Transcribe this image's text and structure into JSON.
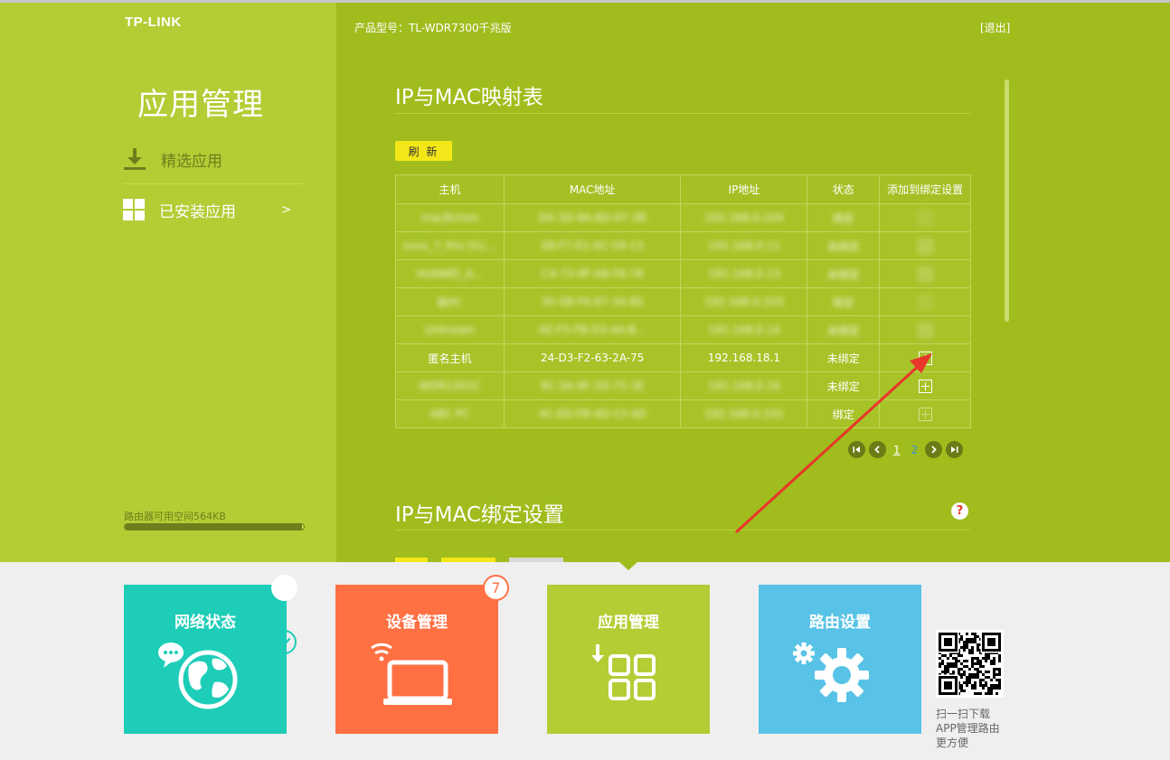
{
  "header": {
    "brand": "TP-LINK",
    "product": "产品型号：TL-WDR7300千兆版",
    "logout": "[退出]"
  },
  "sidebar": {
    "title": "应用管理",
    "items": [
      {
        "label": "精选应用",
        "icon": "download-icon",
        "active": false
      },
      {
        "label": "已安装应用",
        "icon": "grid-icon",
        "active": true,
        "arrow": ">"
      }
    ],
    "storage_text": "路由器可用空间564KB",
    "storage_fill": 0.99
  },
  "mapping": {
    "title": "IP与MAC映射表",
    "refresh": "刷 新",
    "columns": [
      "主机",
      "MAC地址",
      "IP地址",
      "状态",
      "添加到绑定设置"
    ],
    "rows": [
      {
        "host": "macBchen",
        "mac": "D4-3D-8A-8D-97-3B",
        "ip": "192.168.0.104",
        "status": "绑定",
        "blur": true,
        "status_blur": true,
        "add_enabled": false
      },
      {
        "host": "xxxx_7_Pro-31c...",
        "mac": "08-F7-E1-0C-59-13",
        "ip": "192.168.0.11",
        "status": "未绑定",
        "blur": true,
        "status_blur": true,
        "add_enabled": true
      },
      {
        "host": "HUAWEI_A...",
        "mac": "C4-73-9F-A8-F8-78",
        "ip": "192.168.0.13",
        "status": "未绑定",
        "blur": true,
        "status_blur": true,
        "add_enabled": true
      },
      {
        "host": "新PC",
        "mac": "30-5B-F6-87-34-85",
        "ip": "192.168.0.103",
        "status": "绑定",
        "blur": true,
        "status_blur": true,
        "add_enabled": false
      },
      {
        "host": "Unknown",
        "mac": "AE-F5-FB-D3-4A-B...",
        "ip": "192.168.0.14",
        "status": "未绑定",
        "blur": true,
        "status_blur": true,
        "add_enabled": true
      },
      {
        "host": "匿名主机",
        "mac": "24-D3-F2-63-2A-75",
        "ip": "192.168.18.1",
        "status": "未绑定",
        "blur": false,
        "status_blur": false,
        "add_enabled": true
      },
      {
        "host": "WDR1301C",
        "mac": "9C-3A-9F-2D-75-3E",
        "ip": "192.168.0.16",
        "status": "未绑定",
        "blur": true,
        "status_blur": false,
        "add_enabled": true
      },
      {
        "host": "ABC PC",
        "mac": "4C-ED-FB-4D-13-4D",
        "ip": "192.168.0.101",
        "status": "绑定",
        "blur": true,
        "status_blur": false,
        "add_enabled": false
      }
    ],
    "pager": {
      "first": "|<",
      "prev": "<",
      "pages": [
        "1",
        "2"
      ],
      "current": "1",
      "next": ">",
      "last": ">|"
    }
  },
  "binding": {
    "title": "IP与MAC绑定设置",
    "help": "?"
  },
  "tiles": [
    {
      "label": "网络状态",
      "color": "#1ecdb8",
      "icon": "globe-chat-icon",
      "badge": "check-icon"
    },
    {
      "label": "设备管理",
      "color": "#ff7043",
      "icon": "laptop-wifi-icon",
      "badge": "7"
    },
    {
      "label": "应用管理",
      "color": "#b5cc35",
      "icon": "apps-download-icon",
      "badge": ""
    },
    {
      "label": "路由设置",
      "color": "#58c3e6",
      "icon": "gear-icon",
      "badge": ""
    }
  ],
  "qr": {
    "text_lines": [
      "扫一扫下载",
      "APP管理路由",
      "更方便"
    ]
  },
  "colors": {
    "left_panel": "#b5cc35",
    "right_panel": "#a0bd1d",
    "button_yellow": "#f4e719",
    "annotation_red": "#e8362b"
  }
}
